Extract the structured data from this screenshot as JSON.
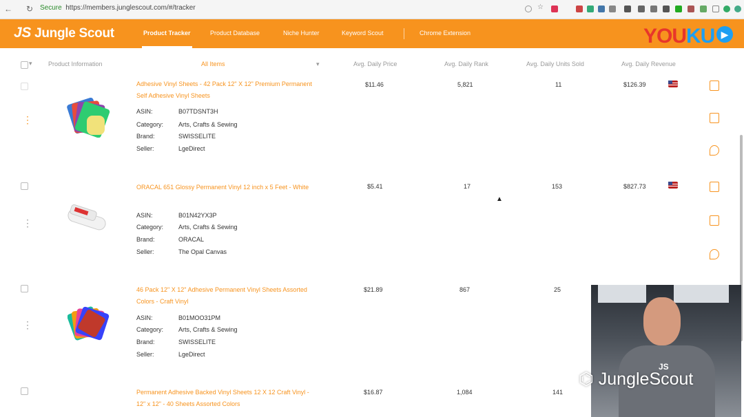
{
  "browser": {
    "security": "Secure",
    "url": "https://members.junglescout.com/#/tracker"
  },
  "header": {
    "logo_mark": "JS",
    "logo_text": "Jungle Scout",
    "nav": [
      {
        "label": "Product Tracker",
        "active": true
      },
      {
        "label": "Product Database"
      },
      {
        "label": "Niche Hunter"
      },
      {
        "label": "Keyword Scout"
      },
      {
        "label": "Chrome Extension"
      }
    ],
    "watermark_text": "YOUKU"
  },
  "table": {
    "headers": {
      "product_info": "Product Information",
      "filter": "All Items",
      "price": "Avg. Daily Price",
      "rank": "Avg. Daily Rank",
      "units": "Avg. Daily Units Sold",
      "revenue": "Avg. Daily Revenue"
    },
    "attr_labels": {
      "asin": "ASIN:",
      "category": "Category:",
      "brand": "Brand:",
      "seller": "Seller:"
    },
    "rows": [
      {
        "title": "Adhesive Vinyl Sheets - 42 Pack 12\" X 12\" Premium Permanent Self Adhesive Vinyl Sheets",
        "asin": "B07TDSNT3H",
        "category": "Arts, Crafts & Sewing",
        "brand": "SWISSELITE",
        "seller": "LgeDirect",
        "price": "$11.46",
        "rank": "5,821",
        "units": "11",
        "revenue": "$126.39"
      },
      {
        "title": "ORACAL 651 Glossy Permanent Vinyl 12 inch x 5 Feet - White",
        "asin": "B01N42YX3P",
        "category": "Arts, Crafts & Sewing",
        "brand": "ORACAL",
        "seller": "The Opal Canvas",
        "price": "$5.41",
        "rank": "17",
        "units": "153",
        "revenue": "$827.73"
      },
      {
        "title": "46 Pack 12\" X 12\" Adhesive Permanent Vinyl Sheets Assorted Colors - Craft Vinyl",
        "asin": "B01MOO31PM",
        "category": "Arts, Crafts & Sewing",
        "brand": "SWISSELITE",
        "seller": "LgeDirect",
        "price": "$21.89",
        "rank": "867",
        "units": "25",
        "revenue": ""
      },
      {
        "title": "Permanent Adhesive Backed Vinyl Sheets 12 X 12 Craft Vinyl - 12\" x 12\" - 40 Sheets Assorted Colors",
        "price": "$16.87",
        "rank": "1,084",
        "units": "141",
        "revenue": ""
      }
    ]
  },
  "overlay": {
    "watermark": "JungleScout"
  },
  "colors": {
    "brand_orange": "#f7931e",
    "youku_red": "#e8362a",
    "youku_blue": "#1e9ff2"
  }
}
